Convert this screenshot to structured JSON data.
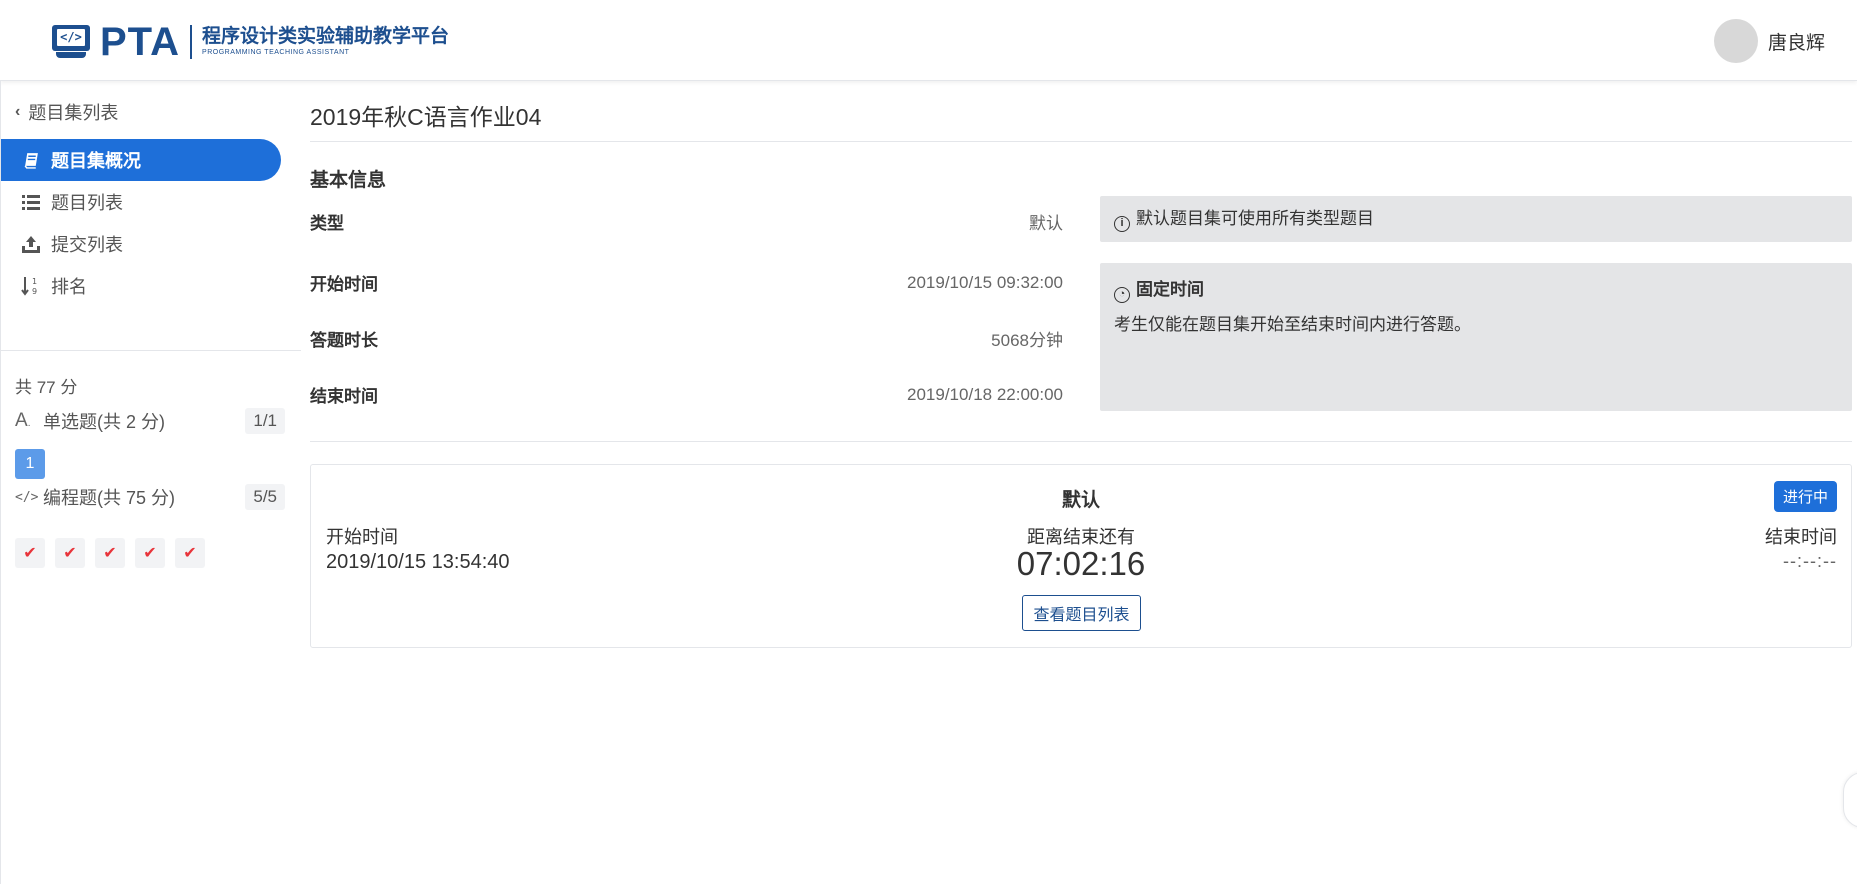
{
  "header": {
    "logo_text": "PTA",
    "logo_cn": "程序设计类实验辅助教学平台",
    "logo_en": "PROGRAMMING TEACHING ASSISTANT",
    "user_name": "唐良辉"
  },
  "sidebar": {
    "back_label": "题目集列表",
    "nav": [
      {
        "label": "题目集概况",
        "icon": "book-icon",
        "active": true
      },
      {
        "label": "题目列表",
        "icon": "list-icon",
        "active": false
      },
      {
        "label": "提交列表",
        "icon": "upload-icon",
        "active": false
      },
      {
        "label": "排名",
        "icon": "sort-icon",
        "active": false
      }
    ],
    "total_score": "共 77 分",
    "question_types": [
      {
        "label": "单选题(共 2 分)",
        "count": "1/1",
        "icon": "choice-icon",
        "items": [
          "1"
        ]
      },
      {
        "label": "编程题(共 75 分)",
        "count": "5/5",
        "icon": "code-icon",
        "items": [
          "✔",
          "✔",
          "✔",
          "✔",
          "✔"
        ]
      }
    ]
  },
  "main": {
    "title": "2019年秋C语言作业04",
    "section_title": "基本信息",
    "info": {
      "type_label": "类型",
      "type_value": "默认",
      "start_label": "开始时间",
      "start_value": "2019/10/15 09:32:00",
      "duration_label": "答题时长",
      "duration_value": "5068分钟",
      "end_label": "结束时间",
      "end_value": "2019/10/18 22:00:00"
    },
    "notes": {
      "type_note": "默认题目集可使用所有类型题目",
      "time_head": "固定时间",
      "time_body": "考生仅能在题目集开始至结束时间内进行答题。"
    },
    "card": {
      "title": "默认",
      "status": "进行中",
      "start_label": "开始时间",
      "start_value": "2019/10/15 13:54:40",
      "remain_label": "距离结束还有",
      "countdown": "07:02:16",
      "end_label": "结束时间",
      "end_value": "--:--:--",
      "view_button": "查看题目列表"
    }
  },
  "colors": {
    "primary": "#1e6fd9",
    "brand": "#1d4f8f",
    "note_bg": "#e4e5e7",
    "check": "#e8343a"
  }
}
